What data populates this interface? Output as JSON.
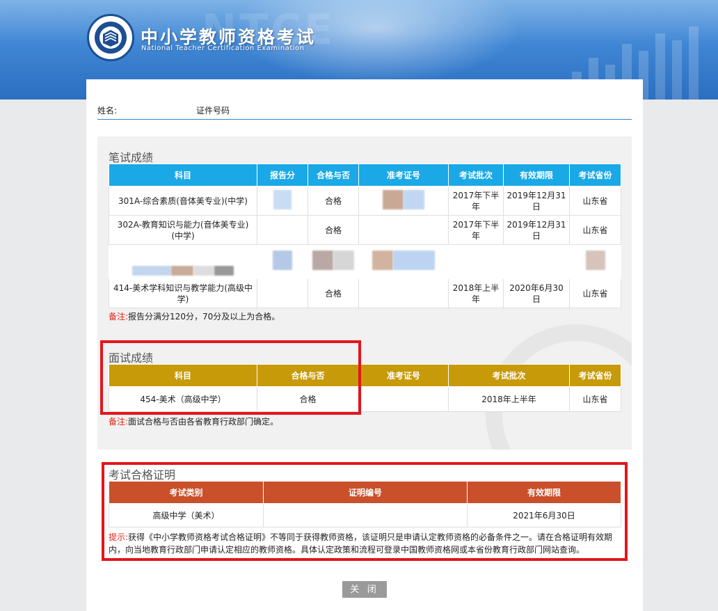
{
  "header": {
    "title_cn": "中小学教师资格考试",
    "title_en": "National Teacher Certification Examination",
    "logo_icon": "teacher-exam-emblem-icon"
  },
  "user": {
    "name_label": "姓名:",
    "id_label": "证件号码"
  },
  "written": {
    "title": "笔试成绩",
    "columns": [
      "科目",
      "报告分",
      "合格与否",
      "准考证号",
      "考试批次",
      "有效期限",
      "考试省份"
    ],
    "rows": [
      {
        "subject": "301A-综合素质(音体美专业)(中学)",
        "score": "",
        "pass": "合格",
        "ticket": "",
        "batch": "2017年下半年",
        "valid": "2019年12月31日",
        "province": "山东省"
      },
      {
        "subject": "302A-教育知识与能力(音体美专业)(中学)",
        "score": "",
        "pass": "合格",
        "ticket": "",
        "batch": "2017年下半年",
        "valid": "2019年12月31日",
        "province": "山东省"
      },
      {
        "subject": "",
        "score": "",
        "pass": "",
        "ticket": "",
        "batch": "",
        "valid": "",
        "province": ""
      },
      {
        "subject": "414-美术学科知识与教学能力(高级中学)",
        "score": "",
        "pass": "合格",
        "ticket": "",
        "batch": "2018年上半年",
        "valid": "2020年6月30日",
        "province": "山东省"
      }
    ],
    "note_label": "备注:",
    "note_text": "报告分满分120分，70分及以上为合格。"
  },
  "interview": {
    "title": "面试成绩",
    "columns": [
      "科目",
      "合格与否",
      "准考证号",
      "考试批次",
      "考试省份"
    ],
    "row": {
      "subject": "454-美术（高级中学）",
      "pass": "合格",
      "ticket": "",
      "batch": "2018年上半年",
      "province": "山东省"
    },
    "note_label": "备注:",
    "note_text": "面试合格与否由各省教育行政部门确定。"
  },
  "certificate": {
    "title": "考试合格证明",
    "columns": [
      "考试类别",
      "证明编号",
      "有效期限"
    ],
    "row": {
      "category": "高级中学（美术）",
      "number": "",
      "valid": "2021年6月30日"
    },
    "tip_label": "提示:",
    "tip_text": "获得《中小学教师资格考试合格证明》不等同于获得教师资格，该证明只是申请认定教师资格的必备条件之一。请在合格证明有效期内，向当地教育行政部门申请认定相应的教师资格。具体认定政策和流程可登录中国教师资格网或本省份教育行政部门网站查询。"
  },
  "close_label": "关 闭",
  "colors": {
    "written_header": "#1aa8e6",
    "interview_header": "#c79a09",
    "certificate_header": "#c9502a",
    "highlight_box": "#e3151c"
  }
}
